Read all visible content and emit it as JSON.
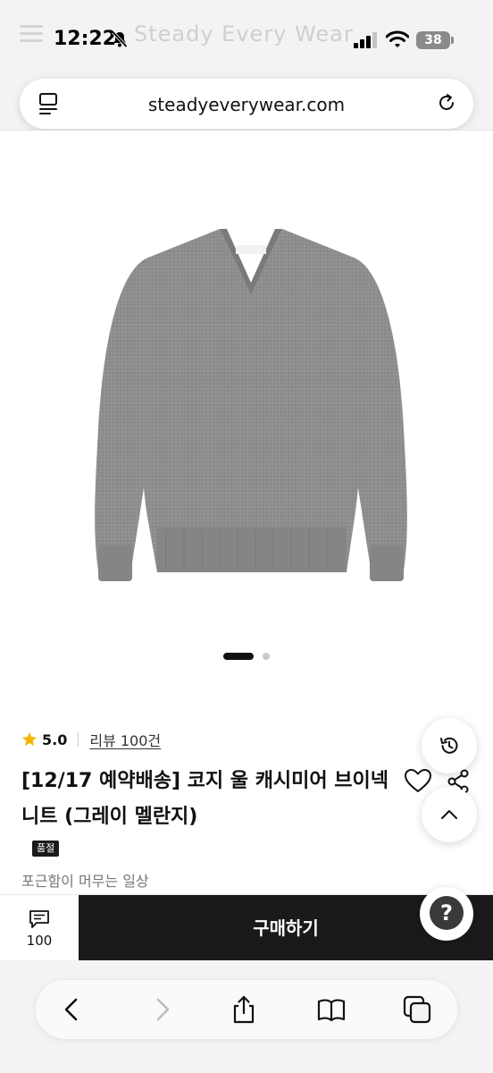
{
  "status_bar": {
    "time": "12:22",
    "battery": "38",
    "ghost_site_title": "Steady Every Wear"
  },
  "browser": {
    "url": "steadyeverywear.com"
  },
  "gallery": {
    "image_count": 2,
    "active_index": 0
  },
  "product": {
    "rating": "5.0",
    "review_link": "리뷰 100건",
    "title": "[12/17 예약배송] 코지 울 캐시미어 브이넥 니트 (그레이 멜란지)",
    "badge": "품절",
    "subtitle": "포근함이 머무는 일상"
  },
  "purchase_bar": {
    "review_count": "100",
    "buy_label": "구매하기"
  },
  "help": {
    "symbol": "?"
  },
  "colors": {
    "accent_dark": "#1a1a1a",
    "star": "#f5b400",
    "sweater": "#8c8c8c"
  }
}
